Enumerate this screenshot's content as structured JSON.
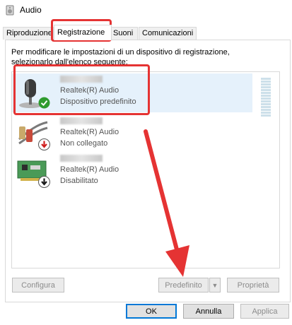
{
  "window": {
    "title": "Audio"
  },
  "tabs": [
    {
      "label": "Riproduzione"
    },
    {
      "label": "Registrazione"
    },
    {
      "label": "Suoni"
    },
    {
      "label": "Comunicazioni"
    }
  ],
  "description": "Per modificare le impostazioni di un dispositivo di registrazione, selezionarlo dall'elenco seguente:",
  "devices": [
    {
      "driver": "Realtek(R) Audio",
      "status": "Dispositivo predefinito",
      "icon": "microphone-icon",
      "badge": "green-check"
    },
    {
      "driver": "Realtek(R) Audio",
      "status": "Non collegato",
      "icon": "line-in-cable-icon",
      "badge": "red-down-arrow"
    },
    {
      "driver": "Realtek(R) Audio",
      "status": "Disabilitato",
      "icon": "sound-card-icon",
      "badge": "black-down-arrow"
    }
  ],
  "buttons": {
    "configure": "Configura",
    "default": "Predefinito",
    "properties": "Proprietà",
    "ok": "OK",
    "cancel": "Annulla",
    "apply": "Applica"
  },
  "colors": {
    "highlight": "#e53333",
    "selection": "#e5f1fb"
  }
}
